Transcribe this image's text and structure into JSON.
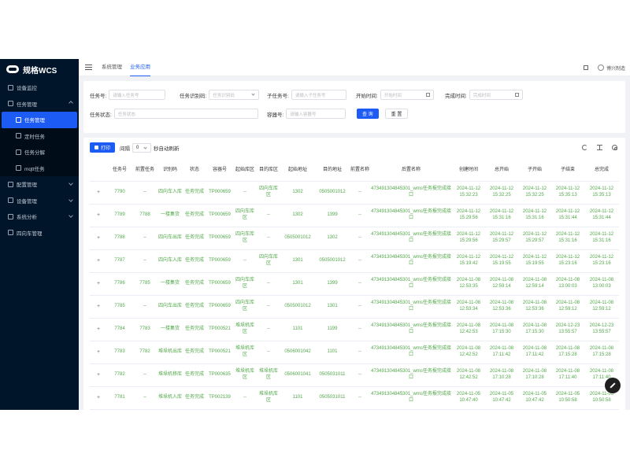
{
  "app": {
    "title": "规格WCS"
  },
  "sidebar": {
    "items": [
      {
        "label": "设备监控",
        "icon": "monitor-icon",
        "type": "item"
      },
      {
        "label": "任务管理",
        "icon": "list-icon",
        "type": "group",
        "expanded": true
      },
      {
        "label": "任务管理",
        "icon": "document-icon",
        "type": "sub",
        "active": true
      },
      {
        "label": "定时任务",
        "icon": "clock-icon",
        "type": "sub"
      },
      {
        "label": "任务分解",
        "icon": "split-icon",
        "type": "sub"
      },
      {
        "label": "mqtt任务",
        "icon": "file-icon",
        "type": "sub"
      },
      {
        "label": "配置管理",
        "icon": "settings-icon",
        "type": "group"
      },
      {
        "label": "设备管理",
        "icon": "device-icon",
        "type": "group"
      },
      {
        "label": "系统分析",
        "icon": "chart-icon",
        "type": "group"
      },
      {
        "label": "四向车管理",
        "icon": "vehicle-icon",
        "type": "item"
      }
    ]
  },
  "header": {
    "tabs": [
      {
        "label": "系统管理"
      },
      {
        "label": "业务应用",
        "active": true
      }
    ],
    "user": "博兴制造"
  },
  "filters": {
    "task_no": {
      "label": "任务号:",
      "placeholder": "请输入任务号"
    },
    "task_code": {
      "label": "任务识别码:",
      "placeholder": "任务识别码"
    },
    "sub_task_no": {
      "label": "子任务号:",
      "placeholder": "请输入子任务号"
    },
    "start_time": {
      "label": "开始时间:",
      "placeholder": "开始时间"
    },
    "end_time": {
      "label": "完成时间:",
      "placeholder": "完成时间"
    },
    "task_status": {
      "label": "任务状态:",
      "placeholder": "任务状态"
    },
    "container_no": {
      "label": "容器号:",
      "placeholder": "请输入容器号"
    },
    "search_label": "查 询",
    "reset_label": "重 置"
  },
  "toolbar": {
    "print_label": "打印",
    "interval_label": "间隔",
    "interval_value": "0",
    "interval_suffix": "秒自动刷新"
  },
  "table": {
    "columns": [
      "",
      "任务号",
      "前置任务",
      "识别码",
      "状态",
      "容器号",
      "起始库区",
      "目的库区",
      "起始地址",
      "目的地址",
      "前置名称",
      "后置名称",
      "创建时间",
      "总开始",
      "子开始",
      "子结束",
      "总完成"
    ],
    "rows": [
      [
        "+",
        "7790",
        "--",
        "四向车入库",
        "任务完成",
        "TP000659",
        "--",
        "四向车库区",
        "1302",
        "0505001012",
        "--",
        "473491304845301_wms任务报完成接口",
        "2024-11-12 15:32:23",
        "2024-11-12 15:32:25",
        "2024-11-12 15:32:25",
        "2024-11-12 15:35:13",
        "2024-11-12 15:35:13"
      ],
      [
        "+",
        "7789",
        "7788",
        "一楼集货",
        "任务完成",
        "TP000659",
        "四向车库区",
        "--",
        "1302",
        "1399",
        "--",
        "473491304845301_wms任务报完成接口",
        "2024-11-12 15:29:56",
        "2024-11-12 15:31:16",
        "2024-11-12 15:31:16",
        "2024-11-12 15:31:44",
        "2024-11-12 15:31:44"
      ],
      [
        "+",
        "7788",
        "--",
        "四向车出库",
        "任务完成",
        "TP000659",
        "四向车库区",
        "--",
        "0505001012",
        "1302",
        "--",
        "473491304845301_wms任务报完成接口",
        "2024-11-12 15:29:56",
        "2024-11-12 15:29:57",
        "2024-11-12 15:29:57",
        "2024-11-12 15:31:16",
        "2024-11-12 15:31:16"
      ],
      [
        "+",
        "7787",
        "--",
        "四向车入库",
        "任务完成",
        "TP000659",
        "--",
        "四向车库区",
        "1301",
        "0505001012",
        "--",
        "473491304845301_wms任务报完成接口",
        "2024-11-12 15:19:42",
        "2024-11-12 15:19:55",
        "2024-11-12 15:19:55",
        "2024-11-12 15:23:16",
        "2024-11-12 15:23:16"
      ],
      [
        "+",
        "7786",
        "7785",
        "一楼集货",
        "任务完成",
        "TP000659",
        "四向车库区",
        "--",
        "1301",
        "1399",
        "--",
        "473491304845301_wms任务报完成接口",
        "2024-11-08 12:53:35",
        "2024-11-08 12:59:14",
        "2024-11-08 12:59:14",
        "2024-11-08 13:00:03",
        "2024-11-08 13:00:03"
      ],
      [
        "+",
        "7785",
        "--",
        "四向车出库",
        "任务完成",
        "TP000659",
        "四向车库区",
        "--",
        "0505001012",
        "1301",
        "--",
        "473491304845301_wms任务报完成接口",
        "2024-11-08 12:53:34",
        "2024-11-08 12:53:36",
        "2024-11-08 12:53:36",
        "2024-11-08 12:59:12",
        "2024-11-08 12:59:12"
      ],
      [
        "+",
        "7784",
        "7783",
        "一楼集货",
        "任务完成",
        "TP000521",
        "堆垛机库区",
        "--",
        "1101",
        "1199",
        "--",
        "473491304845301_wms任务报完成接口",
        "2024-11-08 12:42:53",
        "2024-11-08 17:15:30",
        "2024-11-08 17:15:30",
        "2024-12-23 13:55:57",
        "2024-12-23 13:55:57"
      ],
      [
        "+",
        "7783",
        "7782",
        "堆垛机出库",
        "任务完成",
        "TP000521",
        "堆垛机库区",
        "--",
        "0506001042",
        "1101",
        "--",
        "473491304845301_wms任务报完成接口",
        "2024-11-08 12:42:52",
        "2024-11-08 17:11:42",
        "2024-11-08 17:11:42",
        "2024-11-08 17:15:28",
        "2024-11-08 17:15:28"
      ],
      [
        "+",
        "7782",
        "--",
        "堆垛机移库",
        "任务完成",
        "TP000635",
        "堆垛机库区",
        "堆垛机库区",
        "0506001041",
        "0505031011",
        "--",
        "473491304845301_wms任务报完成接口",
        "2024-11-08 12:42:52",
        "2024-11-08 17:10:28",
        "2024-11-08 17:10:28",
        "2024-11-08 17:11:40",
        "2024-11-08 17:11:40"
      ],
      [
        "+",
        "7781",
        "--",
        "堆垛机入库",
        "任务完成",
        "TP002139",
        "--",
        "堆垛机库区",
        "1101",
        "0505031011",
        "--",
        "473491304845301_wms任务报完成接口",
        "2024-11-05 10:47:40",
        "2024-11-05 10:47:42",
        "2024-11-05 10:47:42",
        "2024-11-05 10:50:58",
        "2024-11-05 10:50:58"
      ]
    ]
  },
  "colors": {
    "primary": "#1d5bf5",
    "sidebar": "#001529",
    "cell_text": "#52a84a"
  }
}
